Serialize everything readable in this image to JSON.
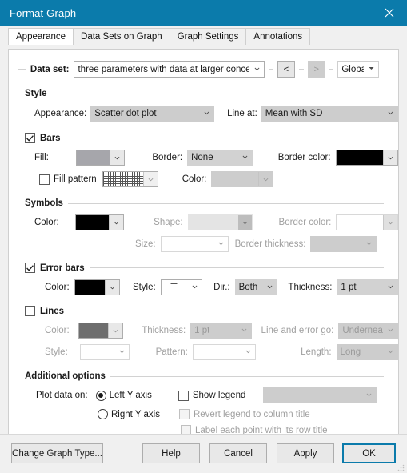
{
  "window": {
    "title": "Format Graph",
    "close_icon": "close-icon"
  },
  "tabs": [
    {
      "label": "Appearance",
      "active": true
    },
    {
      "label": "Data Sets on Graph",
      "active": false
    },
    {
      "label": "Graph Settings",
      "active": false
    },
    {
      "label": "Annotations",
      "active": false
    }
  ],
  "dataset": {
    "label": "Data set:",
    "value": "three parameters with data at larger concentrations",
    "prev_label": "<",
    "next_label": ">",
    "scope_value": "Global"
  },
  "style": {
    "title": "Style",
    "appearance_label": "Appearance:",
    "appearance_value": "Scatter dot plot",
    "line_at_label": "Line at:",
    "line_at_value": "Mean with SD"
  },
  "bars": {
    "title": "Bars",
    "checked": true,
    "fill_label": "Fill:",
    "fill_color": "#a6a6ab",
    "border_label": "Border:",
    "border_value": "None",
    "border_color_label": "Border color:",
    "border_color": "#000000",
    "fill_pattern_label": "Fill pattern",
    "fill_pattern_checked": false,
    "pattern_color_label": "Color:",
    "pattern_color": "#cdcdcd"
  },
  "symbols": {
    "title": "Symbols",
    "color_label": "Color:",
    "color": "#000000",
    "shape_label": "Shape:",
    "shape_value": "",
    "size_label": "Size:",
    "size_value": "",
    "border_color_label": "Border color:",
    "border_color": "#ffffff",
    "border_thickness_label": "Border thickness:",
    "border_thickness_value": ""
  },
  "error_bars": {
    "title": "Error bars",
    "checked": true,
    "color_label": "Color:",
    "color": "#000000",
    "style_label": "Style:",
    "style_value": "T-cap",
    "dir_label": "Dir.:",
    "dir_value": "Both",
    "thickness_label": "Thickness:",
    "thickness_value": "1 pt"
  },
  "lines": {
    "title": "Lines",
    "checked": false,
    "color_label": "Color:",
    "color": "#6e6e6e",
    "thickness_label": "Thickness:",
    "thickness_value": "1 pt",
    "line_error_go_label": "Line and error go:",
    "line_error_go_value": "Underneath",
    "style_label": "Style:",
    "style_value": "",
    "pattern_label": "Pattern:",
    "pattern_value": "",
    "length_label": "Length:",
    "length_value": "Long"
  },
  "additional": {
    "title": "Additional options",
    "plot_data_on_label": "Plot data on:",
    "left_axis_label": "Left Y axis",
    "right_axis_label": "Right  Y axis",
    "selected_axis": "left",
    "show_legend_label": "Show legend",
    "show_legend_checked": false,
    "legend_select_value": "",
    "revert_legend_label": "Revert legend to column title",
    "revert_legend_checked": false,
    "label_each_point_label": "Label each point with its row title",
    "label_each_point_checked": false
  },
  "footer": {
    "change_graph_type": "Change Graph Type...",
    "help": "Help",
    "cancel": "Cancel",
    "apply": "Apply",
    "ok": "OK"
  },
  "colors": {
    "title_bar": "#0b7bab",
    "accent": "#0b7bab",
    "dialog_bg": "#f0f0f0",
    "panel_bg": "#ffffff"
  }
}
